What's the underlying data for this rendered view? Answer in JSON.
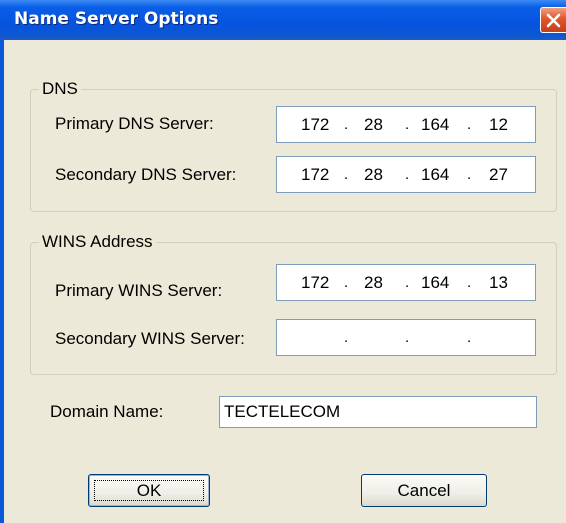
{
  "window": {
    "title": "Name Server Options"
  },
  "dns_group": {
    "legend": "DNS",
    "primary_label": "Primary DNS Server:",
    "primary_octets": [
      "172",
      "28",
      "164",
      "12"
    ],
    "secondary_label": "Secondary DNS Server:",
    "secondary_octets": [
      "172",
      "28",
      "164",
      "27"
    ]
  },
  "wins_group": {
    "legend": "WINS Address",
    "primary_label": "Primary WINS Server:",
    "primary_octets": [
      "172",
      "28",
      "164",
      "13"
    ],
    "secondary_label": "Secondary WINS Server:",
    "secondary_octets": [
      "",
      "",
      "",
      ""
    ]
  },
  "domain": {
    "label": "Domain Name:",
    "value": "TECTELECOM"
  },
  "buttons": {
    "ok_label": "OK",
    "cancel_label": "Cancel"
  },
  "icons": {
    "close": "close-icon"
  },
  "colors": {
    "titlebar": "#0554e0",
    "face": "#ece9d8",
    "close": "#e0572a"
  }
}
